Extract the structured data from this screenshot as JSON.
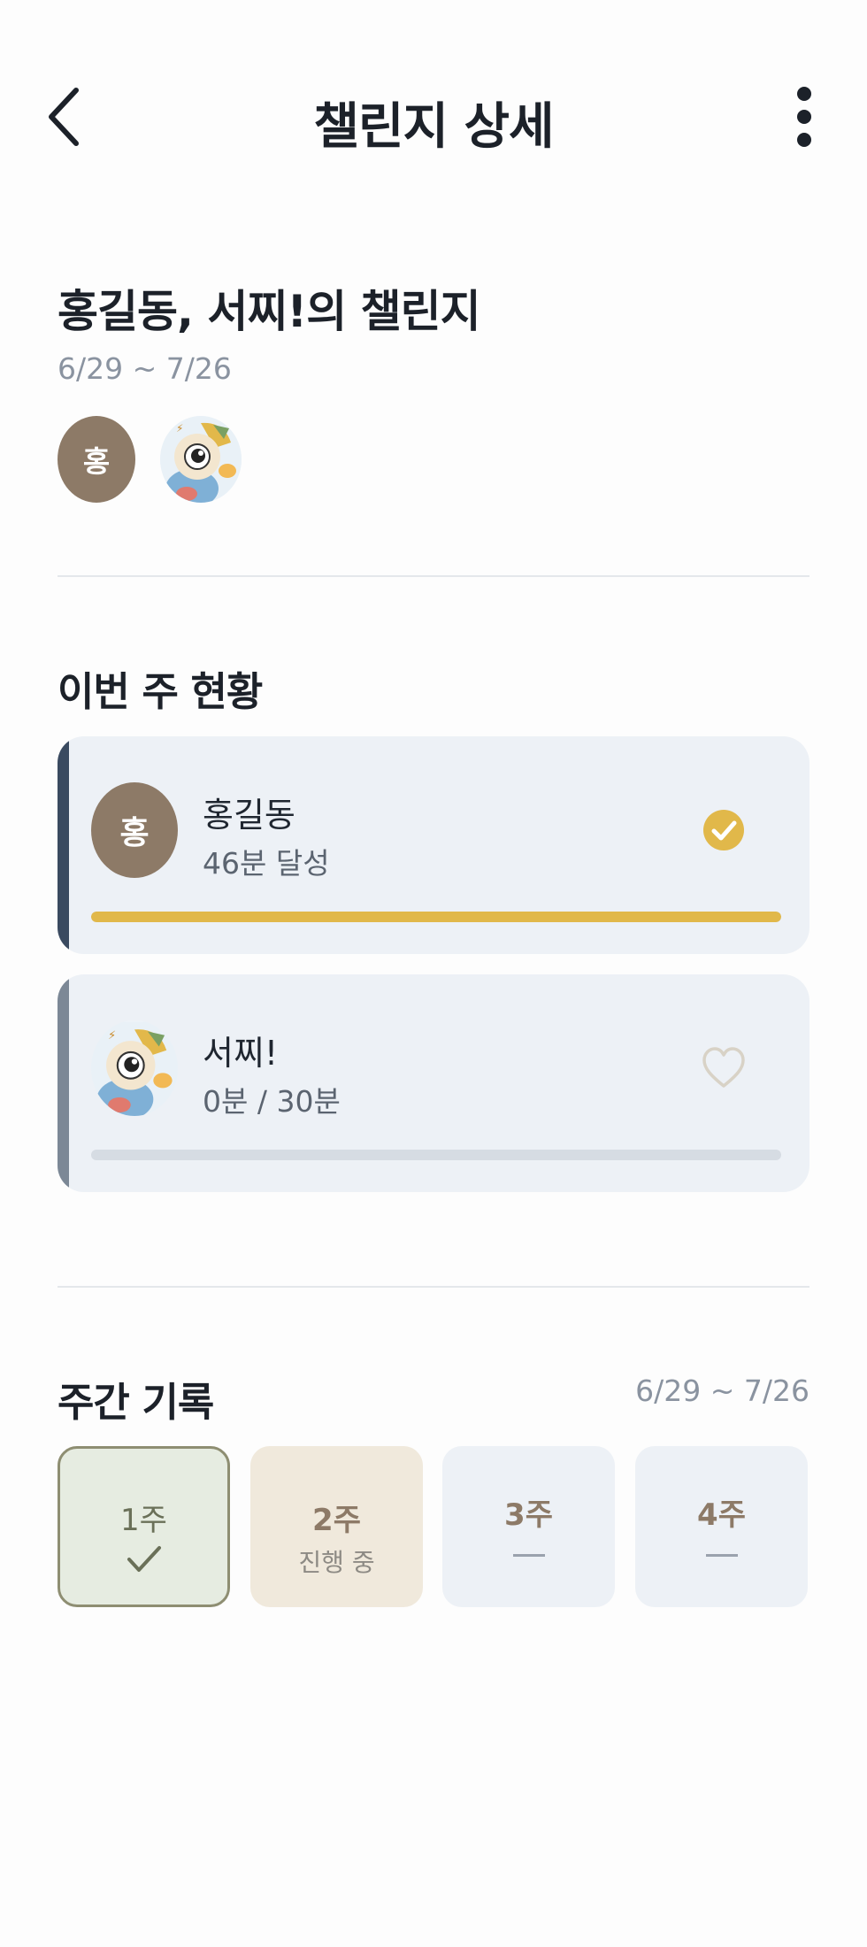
{
  "header": {
    "title": "챌린지 상세",
    "back_icon": "chevron-left-icon",
    "more_icon": "more-vertical-icon"
  },
  "challenge": {
    "title": "홍길동, 서찌!의 챌린지",
    "dates": "6/29 ~ 7/26",
    "members": [
      {
        "initial": "홍",
        "type": "letter"
      },
      {
        "type": "image"
      }
    ]
  },
  "this_week": {
    "title": "이번 주 현황",
    "cards": [
      {
        "name": "홍길동",
        "initial": "홍",
        "status": "46분 달성",
        "progress": 1.0,
        "icon": "check-circle-icon",
        "accent": "#3a4a60"
      },
      {
        "name": "서찌!",
        "status": "0분 / 30분",
        "progress": 0.0,
        "icon": "heart-outline-icon",
        "accent": "#7c8896"
      }
    ]
  },
  "weekly": {
    "title": "주간 기록",
    "dates": "6/29 ~ 7/26",
    "weeks": [
      {
        "label": "1주",
        "state": "done",
        "icon": "checkmark-icon"
      },
      {
        "label": "2주",
        "state": "current",
        "status": "진행 중"
      },
      {
        "label": "3주",
        "state": "upcoming"
      },
      {
        "label": "4주",
        "state": "upcoming"
      }
    ]
  },
  "colors": {
    "accent_gold": "#e1b84a",
    "avatar_brown": "#8d7a67",
    "card_bg": "#edf1f6"
  }
}
